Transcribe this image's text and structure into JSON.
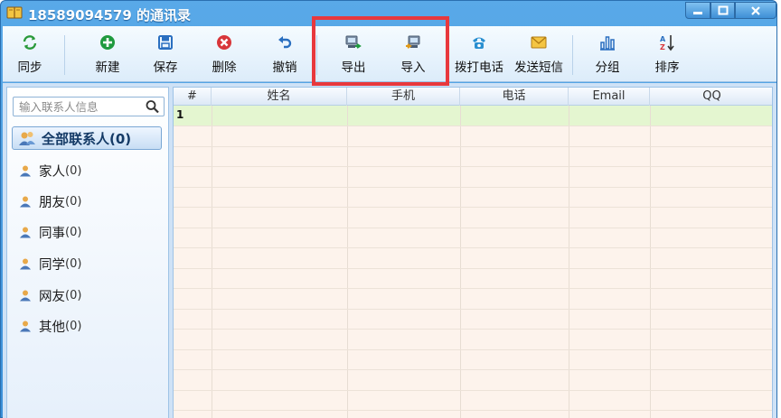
{
  "window": {
    "title": "18589094579 的通讯录",
    "controls": [
      "minimize-icon",
      "maximize-icon",
      "close-icon"
    ]
  },
  "toolbar": {
    "sync": "同步",
    "new": "新建",
    "save": "保存",
    "delete": "删除",
    "undo": "撤销",
    "export": "导出",
    "import": "导入",
    "call": "拨打电话",
    "sms": "发送短信",
    "group": "分组",
    "sort": "排序"
  },
  "sidebar": {
    "search_placeholder": "输入联系人信息",
    "all_contacts": "全部联系人(0)",
    "groups": [
      {
        "label": "家人",
        "count": "(0)"
      },
      {
        "label": "朋友",
        "count": "(0)"
      },
      {
        "label": "同事",
        "count": "(0)"
      },
      {
        "label": "同学",
        "count": "(0)"
      },
      {
        "label": "网友",
        "count": "(0)"
      },
      {
        "label": "其他",
        "count": "(0)"
      }
    ]
  },
  "grid": {
    "columns": [
      "#",
      "姓名",
      "手机",
      "电话",
      "Email",
      "QQ"
    ],
    "rows": [
      {
        "num": "1"
      }
    ]
  },
  "colors": {
    "highlight": "#e8383d",
    "titlebar": "#3a8fd8",
    "selected_row": "#e4f6d0"
  }
}
